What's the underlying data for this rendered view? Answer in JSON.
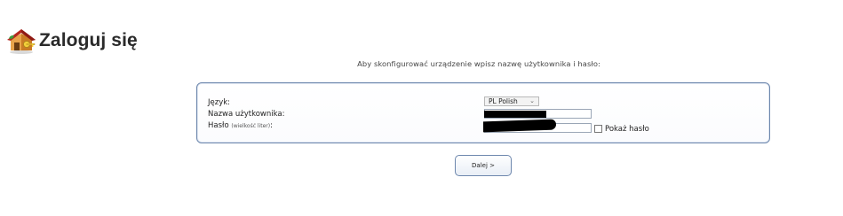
{
  "header": {
    "logo_icon": "house-key-icon",
    "title": "Zaloguj się"
  },
  "instruction": "Aby skonfigurować urządzenie wpisz nazwę użytkownika i hasło:",
  "form": {
    "language_label": "Język:",
    "language_selected": "PL Polish",
    "username_label": "Nazwa użytkownika:",
    "password_label": "Hasło",
    "password_hint": "(wielkość liter)",
    "password_colon": ":",
    "show_password_label": "Pokaż hasło"
  },
  "next_button": "Dalej >",
  "colors": {
    "panel_border": "#6d87ad",
    "redaction": "#000000"
  }
}
